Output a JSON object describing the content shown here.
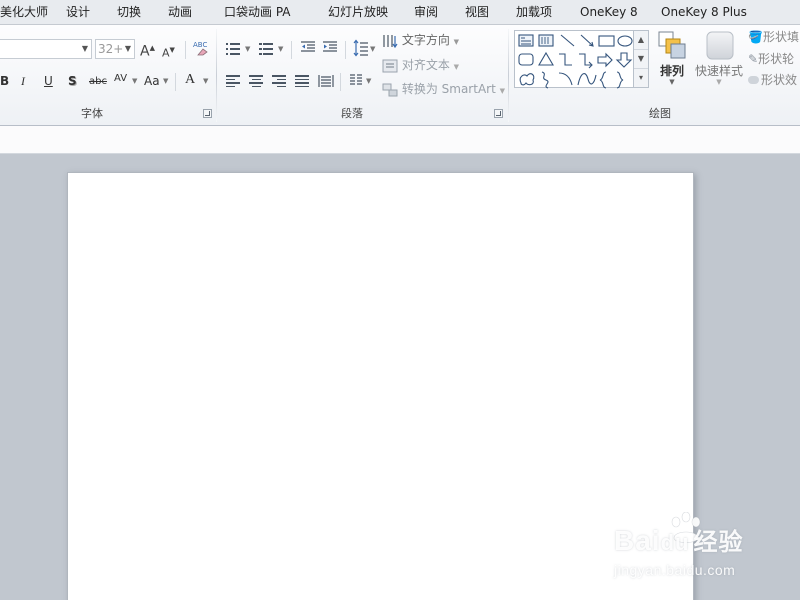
{
  "tabs": [
    {
      "label": "美化大师",
      "name": "tab-meihua"
    },
    {
      "label": "设计",
      "name": "tab-design"
    },
    {
      "label": "切换",
      "name": "tab-transitions"
    },
    {
      "label": "动画",
      "name": "tab-animations"
    },
    {
      "label": "口袋动画 PA",
      "name": "tab-pocket-animation"
    },
    {
      "label": "幻灯片放映",
      "name": "tab-slideshow"
    },
    {
      "label": "审阅",
      "name": "tab-review"
    },
    {
      "label": "视图",
      "name": "tab-view"
    },
    {
      "label": "加载项",
      "name": "tab-addins"
    },
    {
      "label": "OneKey 8",
      "name": "tab-onekey8"
    },
    {
      "label": "OneKey 8 Plus",
      "name": "tab-onekey8-plus"
    }
  ],
  "font_group": {
    "label": "字体",
    "font_name": "",
    "font_size": "32+",
    "grow_label": "A",
    "shrink_label": "A",
    "bold": "B",
    "italic": "I",
    "underline": "U",
    "shadow": "S",
    "strike": "abc",
    "spacing": "AV",
    "change_case": "Aa",
    "font_color": "A"
  },
  "paragraph_group": {
    "label": "段落",
    "text_direction": "文字方向",
    "align_text": "对齐文本",
    "convert_smartart": "转换为 SmartArt"
  },
  "drawing_group": {
    "label": "绘图",
    "arrange": "排列",
    "quick_styles": "快速样式",
    "shape_fill": "形状填",
    "shape_outline": "形状轮",
    "shape_effects": "形状效"
  },
  "watermark": {
    "main": "Bai",
    "main_suffix": "经验",
    "du": "du",
    "sub": "jingyan.baidu.com"
  },
  "colors": {
    "accent_blue": "#2b5797",
    "workspace": "#c1c7cf",
    "ribbon": "#f6f8fa"
  }
}
